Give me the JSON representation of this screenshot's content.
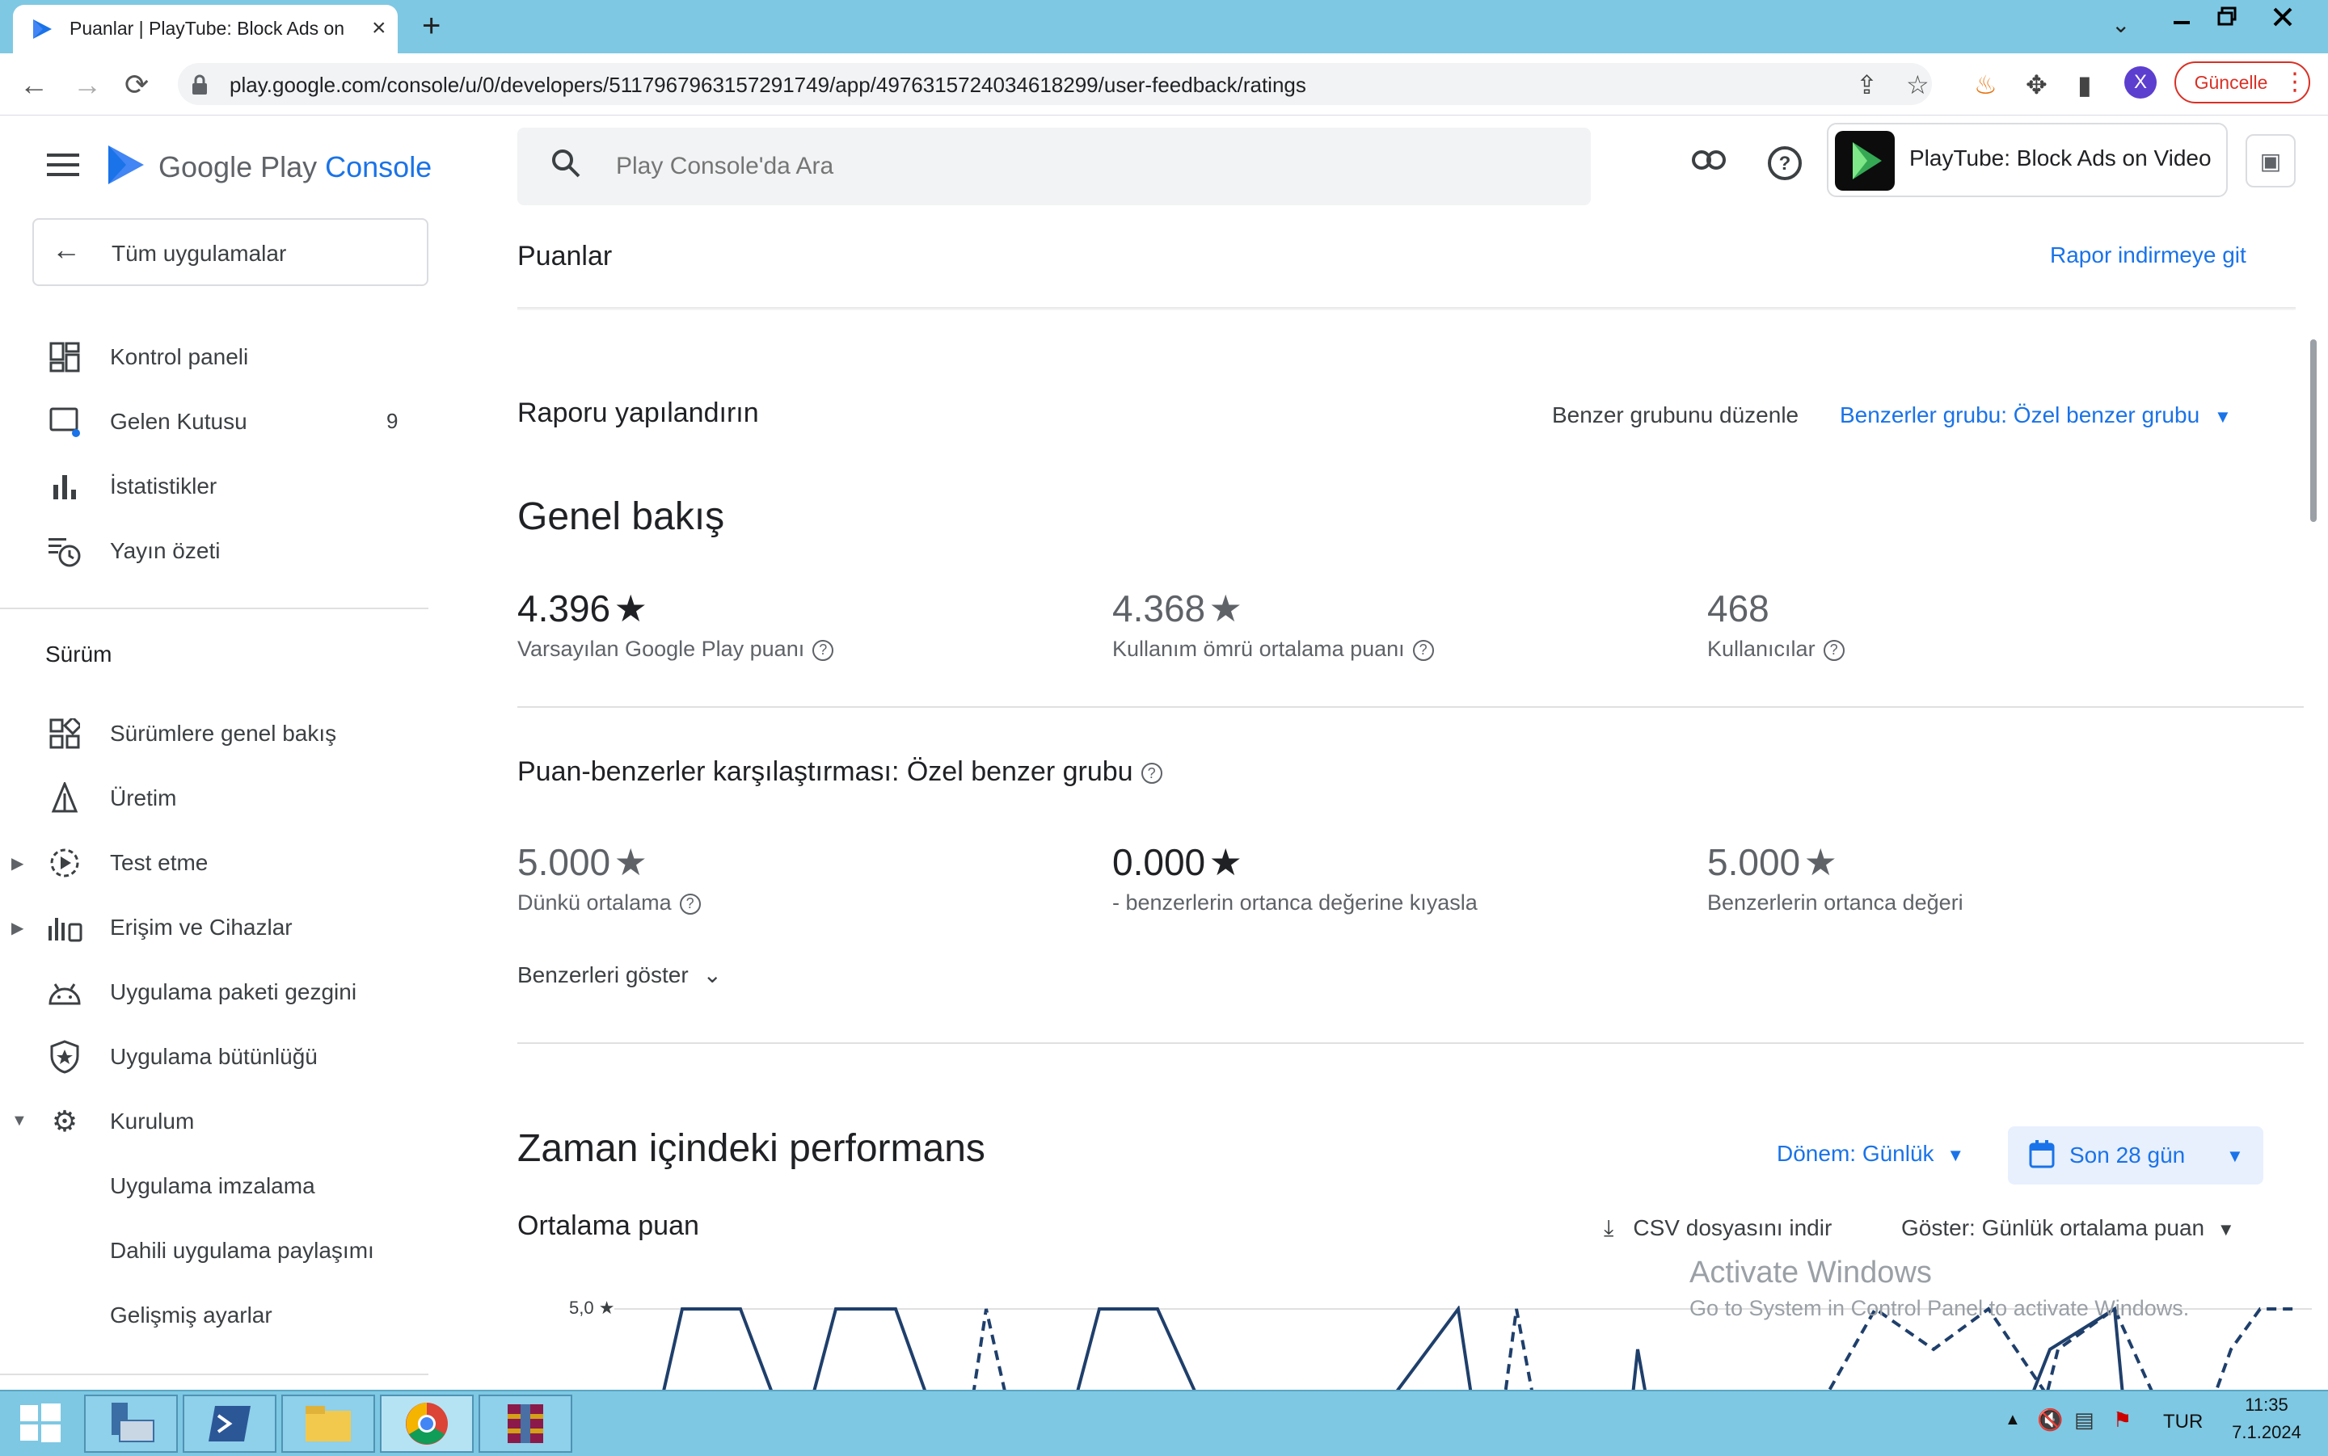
{
  "browser": {
    "tab_title": "Puanlar | PlayTube: Block Ads on",
    "url": "play.google.com/console/u/0/developers/5117967963157291749/app/4976315724034618299/user-feedback/ratings",
    "update_label": "Güncelle",
    "avatar_letter": "X"
  },
  "sidebar": {
    "brand_google": "Google Play ",
    "brand_console": "Console",
    "all_apps": "Tüm uygulamalar",
    "top_items": [
      {
        "label": "Kontrol paneli"
      },
      {
        "label": "Gelen Kutusu",
        "badge": "9"
      },
      {
        "label": "İstatistikler"
      },
      {
        "label": "Yayın özeti"
      }
    ],
    "section_label": "Sürüm",
    "release_items": [
      {
        "label": "Sürümlere genel bakış"
      },
      {
        "label": "Üretim"
      },
      {
        "label": "Test etme"
      },
      {
        "label": "Erişim ve Cihazlar"
      },
      {
        "label": "Uygulama paketi gezgini"
      },
      {
        "label": "Uygulama bütünlüğü"
      },
      {
        "label": "Kurulum"
      }
    ],
    "setup_sub_items": [
      {
        "label": "Uygulama imzalama"
      },
      {
        "label": "Dahili uygulama paylaşımı"
      },
      {
        "label": "Gelişmiş ayarlar"
      }
    ]
  },
  "header": {
    "search_placeholder": "Play Console'da Ara",
    "app_name": "PlayTube: Block Ads on Video"
  },
  "page": {
    "title": "Puanlar",
    "download_link": "Rapor indirmeye git",
    "configure_title": "Raporu yapılandırın",
    "edit_peers": "Benzer grubunu düzenle",
    "peer_group_select": "Benzerler grubu: Özel benzer grubu"
  },
  "overview": {
    "title": "Genel bakış",
    "metrics": [
      {
        "value": "4.396",
        "label": "Varsayılan Google Play puanı"
      },
      {
        "value": "4.368",
        "label": "Kullanım ömrü ortalama puanı"
      },
      {
        "value": "468",
        "label": "Kullanıcılar"
      }
    ]
  },
  "peers": {
    "title": "Puan-benzerler karşılaştırması: Özel benzer grubu",
    "metrics": [
      {
        "value": "5.000",
        "label": "Dünkü ortalama"
      },
      {
        "value": "0.000",
        "label": "- benzerlerin ortanca değerine kıyasla"
      },
      {
        "value": "5.000",
        "label": "Benzerlerin ortanca değeri"
      }
    ],
    "show_peers": "Benzerleri göster"
  },
  "performance": {
    "title": "Zaman içindeki performans",
    "period_select": "Dönem: Günlük",
    "date_range": "Son 28 gün",
    "chart_title": "Ortalama puan",
    "csv_download": "CSV dosyasını indir",
    "show_select": "Göster: Günlük ortalama puan",
    "y_tick": "5,0 ★"
  },
  "watermark": {
    "line1": "Activate Windows",
    "line2": "Go to System in Control Panel to activate Windows."
  },
  "taskbar": {
    "lang": "TUR",
    "time": "11:35",
    "date": "7.1.2024"
  },
  "colors": {
    "accent": "#1a73e8",
    "chart_line": "#1f3f6b",
    "taskbar": "#7ec8e3"
  }
}
